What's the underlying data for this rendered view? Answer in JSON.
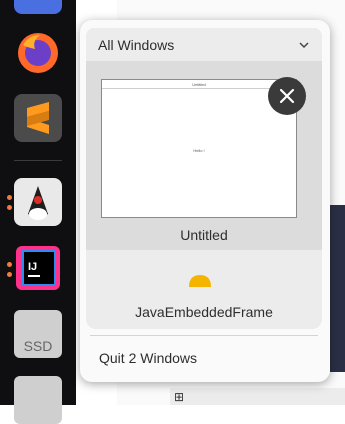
{
  "dock": {
    "apps": [
      {
        "name": "Firefox"
      },
      {
        "name": "Sublime Text"
      },
      {
        "name": "Java application",
        "running": true
      },
      {
        "name": "IntelliJ IDEA",
        "running": true
      },
      {
        "name": "Disk",
        "icon_text": "SSD"
      }
    ]
  },
  "popup": {
    "header_label": "All Windows",
    "windows": [
      {
        "title": "Untitled",
        "thumbnail_title": "Untitled",
        "thumbnail_body": "Hello !"
      },
      {
        "title": "JavaEmbeddedFrame"
      }
    ],
    "quit_label": "Quit 2 Windows"
  },
  "colors": {
    "accent": "#f4b400",
    "close_button": "#3a3a3a",
    "popup_bg": "#fafafa",
    "dock_bg": "#0f0f12"
  }
}
